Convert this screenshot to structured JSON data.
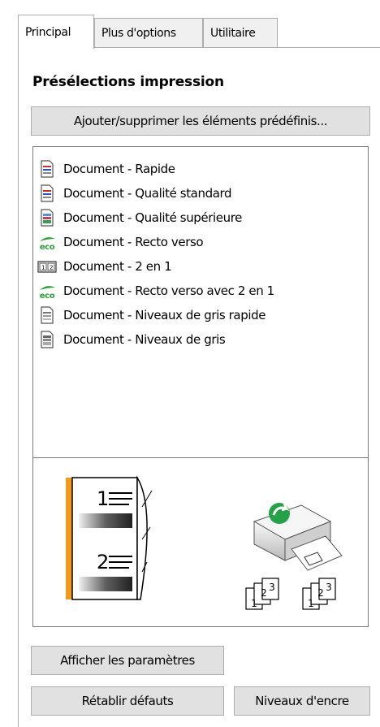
{
  "tabs": [
    {
      "label": "Principal",
      "active": true
    },
    {
      "label": "Plus d'options",
      "active": false
    },
    {
      "label": "Utilitaire",
      "active": false
    }
  ],
  "section_title": "Présélections impression",
  "buttons": {
    "add_remove": "Ajouter/supprimer les éléments prédéfinis...",
    "show_settings": "Afficher les paramètres",
    "reset_defaults": "Rétablir défauts",
    "ink_levels": "Niveaux d'encre"
  },
  "presets": [
    {
      "label": "Document - Rapide",
      "icon": "document-color-icon"
    },
    {
      "label": "Document - Qualité standard",
      "icon": "document-color-icon"
    },
    {
      "label": "Document - Qualité supérieure",
      "icon": "document-color-high-icon"
    },
    {
      "label": "Document - Recto verso",
      "icon": "eco-icon"
    },
    {
      "label": "Document - 2 en 1",
      "icon": "two-up-icon"
    },
    {
      "label": "Document - Recto verso avec 2 en 1",
      "icon": "eco-icon"
    },
    {
      "label": "Document - Niveaux de gris rapide",
      "icon": "document-gray-icon"
    },
    {
      "label": "Document - Niveaux de gris",
      "icon": "document-gray-high-icon"
    }
  ],
  "preview": {
    "page_numbers": [
      "1",
      "2"
    ],
    "collate_labels": [
      "1",
      "2",
      "3"
    ]
  }
}
